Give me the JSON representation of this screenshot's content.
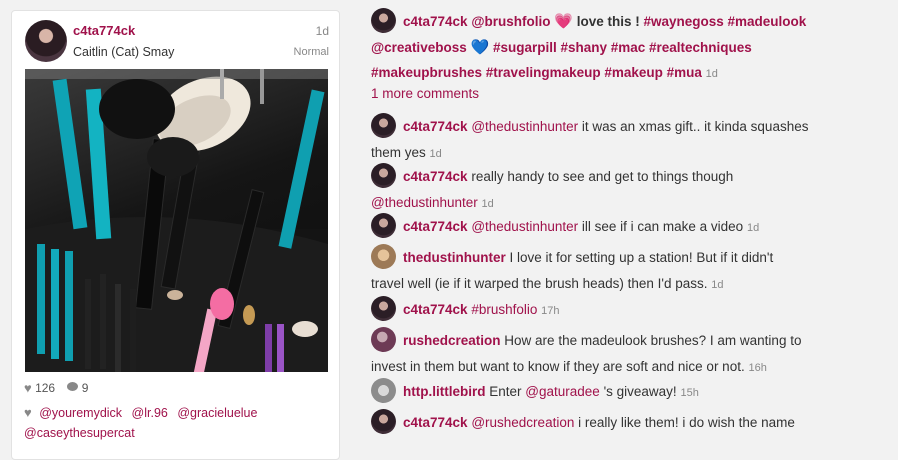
{
  "post": {
    "username": "c4ta774ck",
    "full_name": "Caitlin (Cat) Smay",
    "time": "1d",
    "filter": "Normal",
    "likes": "126",
    "comments": "9",
    "tagged": [
      "@youremydick",
      "@lr.96",
      "@gracieluelue",
      "@caseythesupercat"
    ]
  },
  "caption": {
    "user": "c4ta774ck",
    "mention": "@brushfolio",
    "text": "love this !",
    "hashtags_line1": "#waynegoss #madeulook",
    "mention2": "@creativeboss",
    "hashtags_line2": "#sugarpill #shany #mac #realtechniques",
    "hashtags_line3": "#makeupbrushes #travelingmakeup #makeup #mua",
    "time": "1d"
  },
  "more_comments": "1 more comments",
  "comments": [
    {
      "user": "c4ta774ck",
      "mention": "@thedustinhunter",
      "text1": " it was an xmas gift.. it kinda squashes",
      "text2": "them yes",
      "time": "1d"
    },
    {
      "user": "c4ta774ck",
      "text1": "really handy to see and get to things though",
      "mention2": "@thedustinhunter",
      "time": "1d"
    },
    {
      "user": "c4ta774ck",
      "mention": "@thedustinhunter",
      "text1": " ill see if i can make a video",
      "time": "1d"
    },
    {
      "user": "thedustinhunter",
      "text1": "I love it for setting up a station! But if it didn't",
      "text2": "travel well (ie if it warped the brush heads) then I'd pass.",
      "time": "1d"
    },
    {
      "user": "c4ta774ck",
      "hashtag": "#brushfolio",
      "time": "17h"
    },
    {
      "user": "rushedcreation",
      "text1": "How are the madeulook brushes? I am wanting to",
      "text2": "invest in them but want to know if they are soft and nice or not.",
      "time": "16h"
    },
    {
      "user": "http.littlebird",
      "text1": "Enter",
      "mention": "@gaturadee",
      "text1b": " 's giveaway!",
      "time": "15h"
    },
    {
      "user": "c4ta774ck",
      "mention": "@rushedcreation",
      "text1": " i really like them! i do wish the name"
    }
  ]
}
